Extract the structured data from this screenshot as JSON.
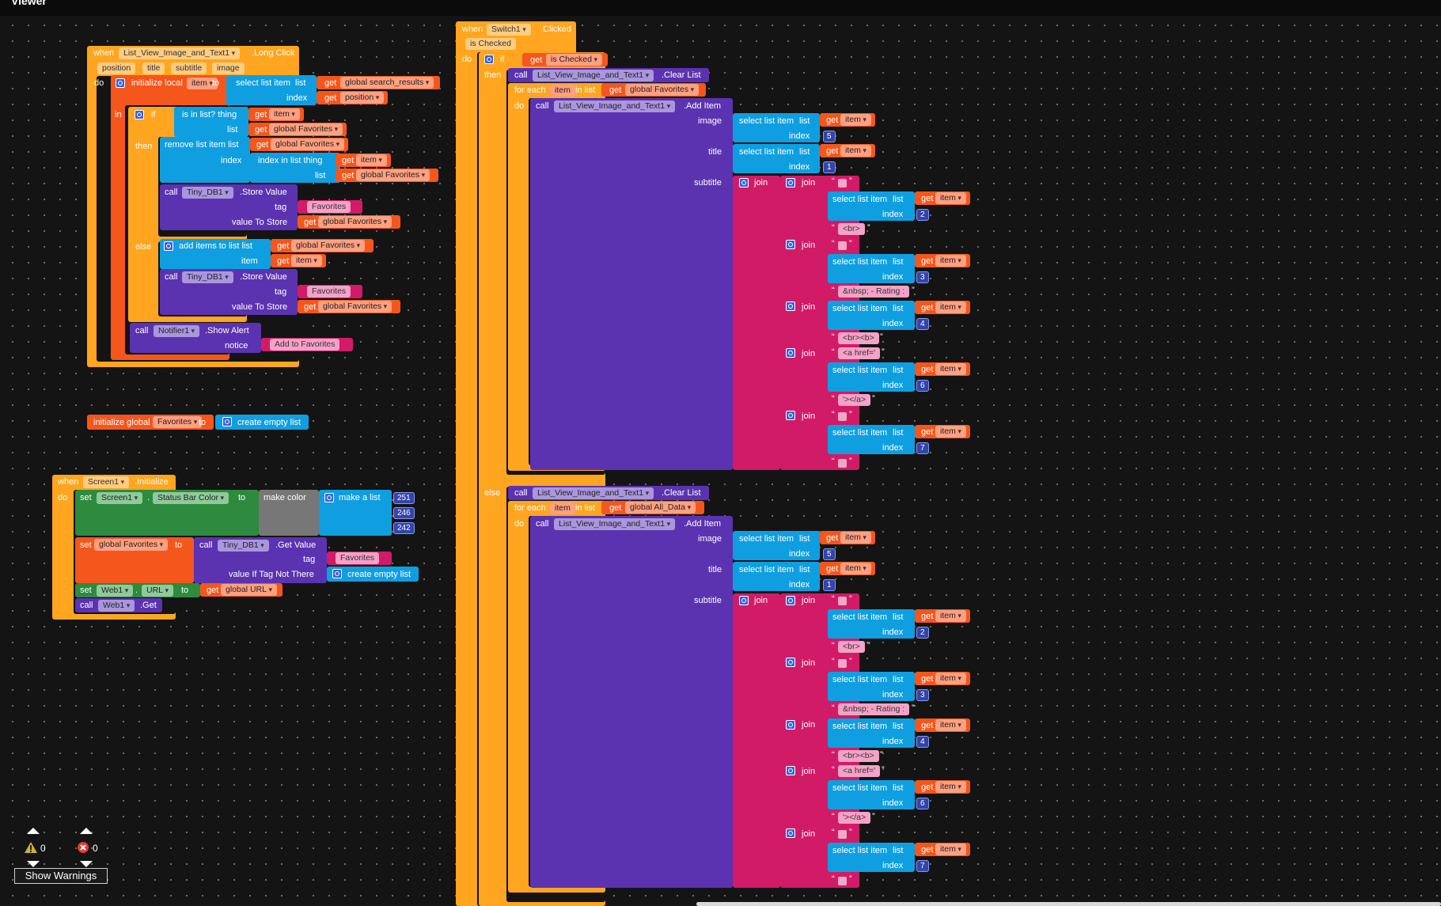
{
  "app": {
    "title": "Viewer"
  },
  "warnings": {
    "warning_count": "0",
    "error_count": "0",
    "show_warnings_label": "Show Warnings"
  },
  "long_click": {
    "when": "when",
    "component": "List_View_Image_and_Text1",
    "event": ".Long Click",
    "params": [
      "position",
      "title",
      "subtitle",
      "image"
    ],
    "do": "do",
    "init_local": "initialize local",
    "local_name": "item",
    "to": "to",
    "select_list_item": "select list item",
    "list": "list",
    "index": "index",
    "get": "get",
    "search_results": "global search_results",
    "position": "position",
    "in": "in",
    "if": "if",
    "then": "then",
    "else": "else",
    "is_in_list": "is in list? thing",
    "item": "item",
    "global_favorites": "global Favorites",
    "remove_list_item": "remove list item  list",
    "index_in_list": "index in list  thing",
    "call": "call",
    "tinydb": "Tiny_DB1",
    "store_value": ".Store Value",
    "tag": "tag",
    "favorites_str": "Favorites",
    "value_to_store": "value To Store",
    "add_items": "add items to list   list",
    "item_label": "item",
    "notifier": "Notifier1",
    "show_alert": ".Show Alert",
    "notice": "notice",
    "add_to_fav": "Add to Favorites"
  },
  "global_init": {
    "initialize_global": "initialize global",
    "name": "Favorites",
    "to": "to",
    "create_empty_list": "create empty list"
  },
  "screen_init": {
    "when": "when",
    "component": "Screen1",
    "event": ".Initialize",
    "do": "do",
    "set": "set",
    "screen": "Screen1",
    "status_bar_color": "Status Bar Color",
    "to": "to",
    "make_color": "make color",
    "make_a_list": "make a list",
    "c1": "251",
    "c2": "246",
    "c3": "242",
    "global_favorites": "global Favorites",
    "call": "call",
    "tinydb": "Tiny_DB1",
    "get_value": ".Get Value",
    "tag": "tag",
    "favorites_str": "Favorites",
    "value_if_not_there": "value If Tag Not There",
    "create_empty_list": "create empty list",
    "web": "Web1",
    "url": "URL",
    "get": "get",
    "global_url": "global URL",
    "get_method": ".Get"
  },
  "switch": {
    "when": "when",
    "component": "Switch1",
    "event": ".Clicked",
    "param": "is Checked",
    "do": "do",
    "if": "if",
    "get": "get",
    "is_checked": "is Checked",
    "then": "then",
    "else": "else",
    "call": "call",
    "lv": "List_View_Image_and_Text1",
    "clear_list": ".Clear List",
    "for_each": "for each",
    "item": "item",
    "in_list": "in list",
    "global_favorites": "global Favorites",
    "global_all_data": "global All_Data",
    "add_item": ".Add Item",
    "image": "image",
    "title": "title",
    "subtitle": "subtitle",
    "select_list_item": "select list item",
    "list": "list",
    "index": "index",
    "join": "join",
    "br": "<br>",
    "rating": "&nbsp; - Rating : ",
    "brb": "<br><b>",
    "ahref": "<a href='",
    "close_a": "'></a>",
    "idx": [
      "5",
      "1",
      "2",
      "3",
      "4",
      "6",
      "7"
    ]
  },
  "colors": {
    "event_orange": "#ffa51f",
    "variables_orange": "#f5561c",
    "lists_blue": "#0f9fe0",
    "component_purple": "#5b33b0",
    "text_pink": "#d11b67",
    "control_orange": "#ffa51f",
    "setter_green": "#2d8a3e",
    "color_gray": "#777777",
    "math_blue": "#3344aa"
  }
}
